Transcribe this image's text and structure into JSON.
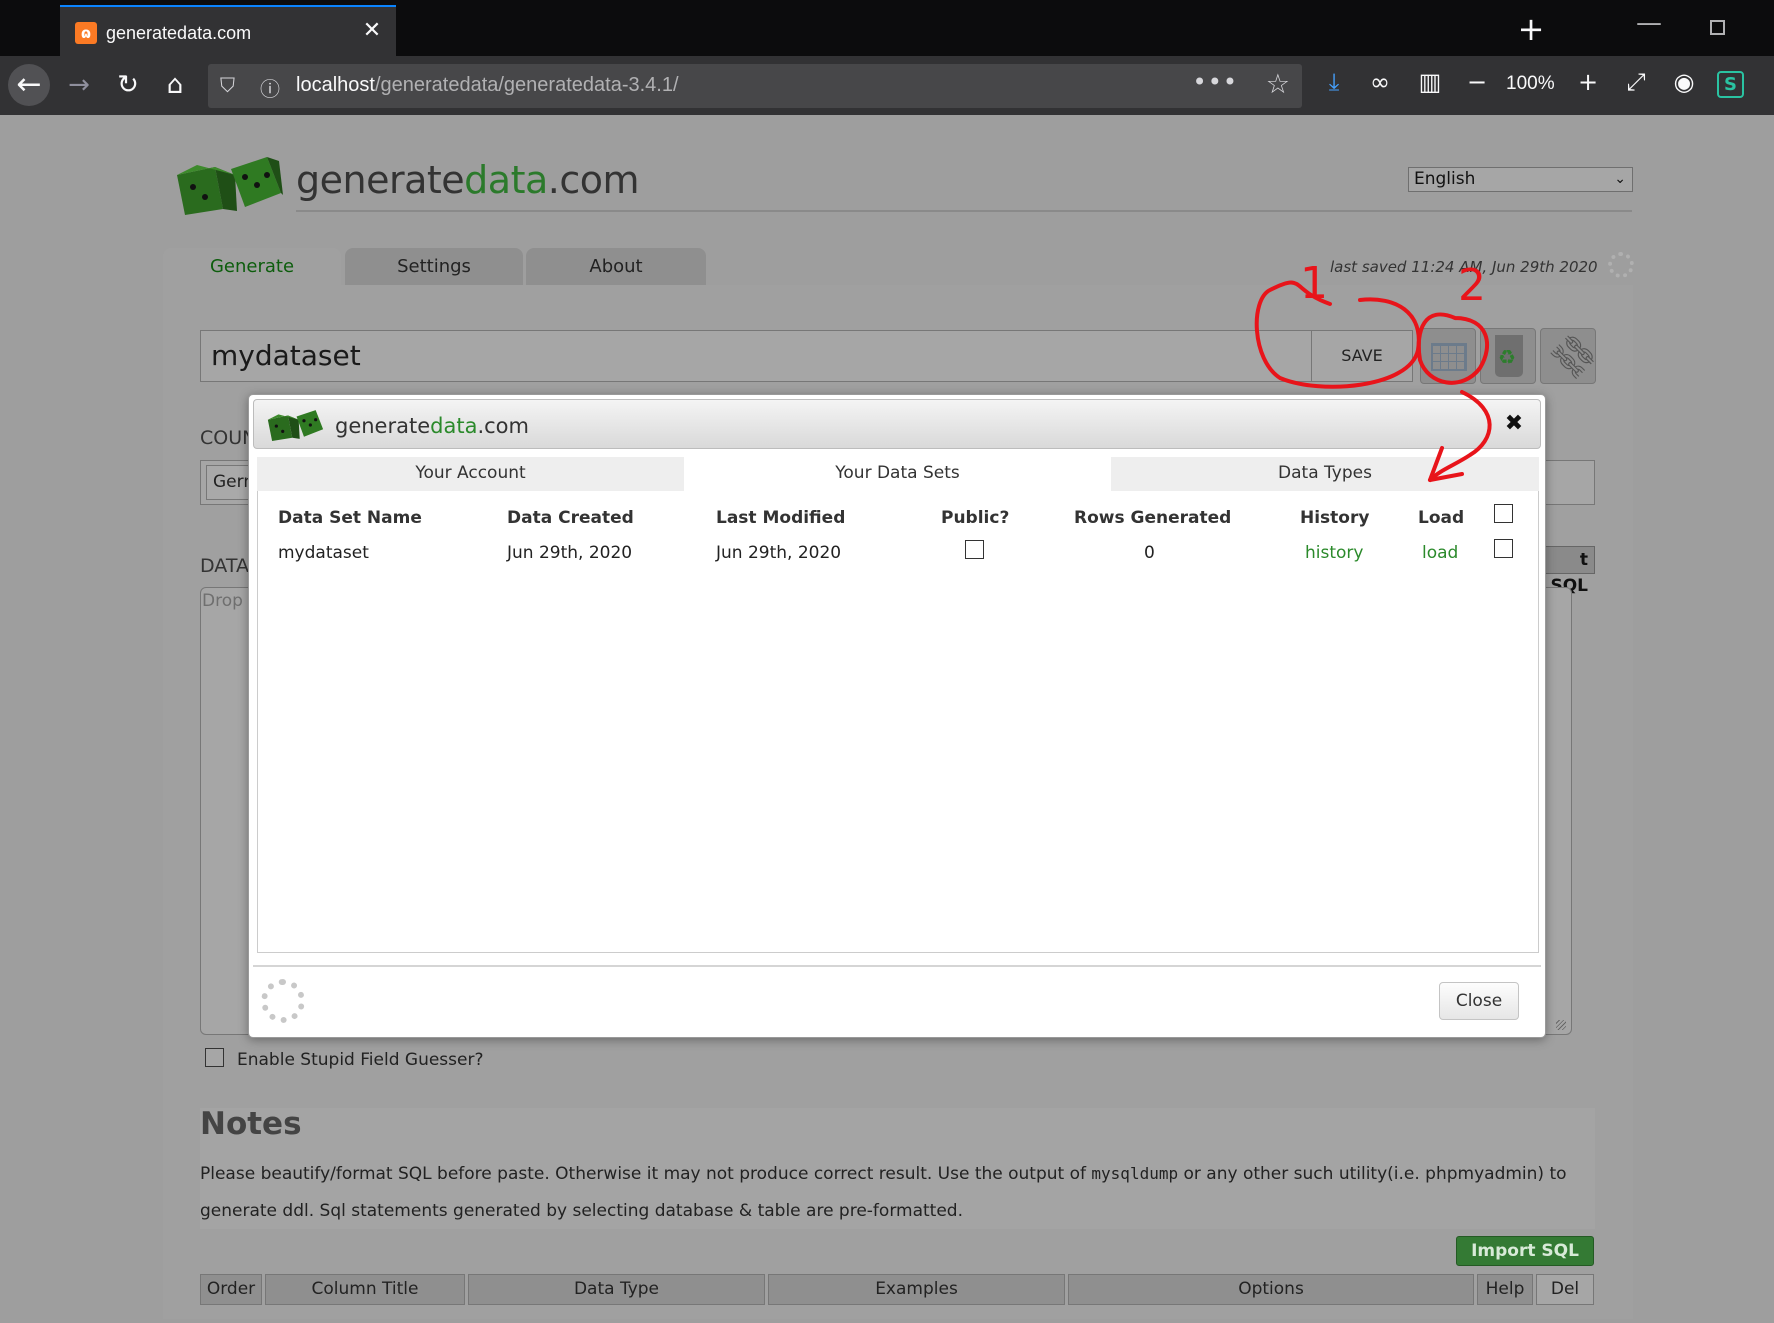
{
  "browser": {
    "tab_title": "generatedata.com",
    "favicon_glyph": "ɷ",
    "url_host": "localhost",
    "url_path": "/generatedata/generatedata-3.4.1/",
    "zoom": "100%",
    "extension_badge": "S"
  },
  "app": {
    "logo_part1": "generate",
    "logo_part2": "data",
    "logo_part3": ".com",
    "language": "English",
    "tabs": [
      {
        "label": "Generate"
      },
      {
        "label": "Settings"
      },
      {
        "label": "About"
      }
    ],
    "last_saved": "last saved 11:24 AM, Jun 29th 2020",
    "dataset_name": "mydataset",
    "save_label": "SAVE",
    "country_label": "COUN",
    "country_value": "Gern",
    "data_label": "DATA",
    "sql_btn": "t SQL",
    "drop_hint": "Drop",
    "guesser_label": "Enable Stupid Field Guesser?",
    "notes_title": "Notes",
    "notes_text_1": "Please beautify/format SQL before paste. Otherwise it may not produce correct result. Use the output of ",
    "notes_code": "mysqldump",
    "notes_text_2": " or any other such utility(i.e. phpmyadmin) to generate ddl. Sql statements generated by selecting database & table are pre-formatted.",
    "import_label": "Import SQL",
    "columns": [
      "Order",
      "Column Title",
      "Data Type",
      "Examples",
      "Options",
      "Help",
      "Del"
    ]
  },
  "modal": {
    "logo_part1": "generate",
    "logo_part2": "data",
    "logo_part3": ".com",
    "close_x": "✖",
    "tabs": [
      {
        "label": "Your Account"
      },
      {
        "label": "Your Data Sets"
      },
      {
        "label": "Data Types"
      }
    ],
    "headers": [
      "Data Set Name",
      "Data Created",
      "Last Modified",
      "Public?",
      "Rows Generated",
      "History",
      "Load"
    ],
    "row": {
      "name": "mydataset",
      "created": "Jun 29th, 2020",
      "modified": "Jun 29th, 2020",
      "rows": "0",
      "history": "history",
      "load": "load"
    },
    "close_label": "Close"
  },
  "annotations": {
    "label_1": "1",
    "label_2": "2",
    "color": "#e8141a"
  }
}
